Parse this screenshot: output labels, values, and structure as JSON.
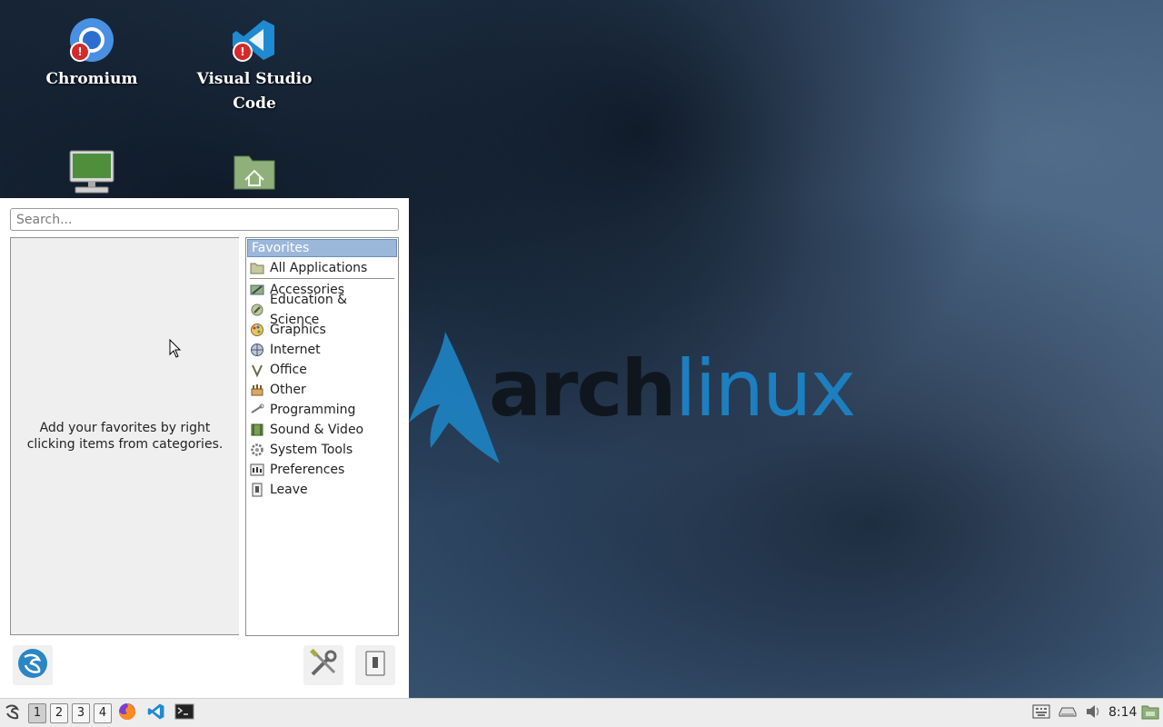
{
  "desktop": {
    "icons": [
      {
        "label": "Chromium",
        "warning": "!"
      },
      {
        "label": "Visual Studio Code",
        "warning": "!"
      },
      {
        "label": "",
        "icon": "computer-icon"
      },
      {
        "label": "",
        "icon": "home-folder-icon"
      }
    ],
    "wallpaper": {
      "logo_word_a": "arch",
      "logo_word_b": "linux"
    }
  },
  "menu": {
    "search_placeholder": "Search...",
    "favorites_hint": "Add your favorites by right clicking items from categories.",
    "categories_header": "Favorites",
    "categories": [
      {
        "label": "All Applications",
        "icon": "folder-icon"
      },
      {
        "label": "Accessories",
        "icon": "accessories-icon"
      },
      {
        "label": "Education & Science",
        "icon": "education-icon"
      },
      {
        "label": "Graphics",
        "icon": "graphics-icon"
      },
      {
        "label": "Internet",
        "icon": "internet-icon"
      },
      {
        "label": "Office",
        "icon": "office-icon"
      },
      {
        "label": "Other",
        "icon": "other-icon"
      },
      {
        "label": "Programming",
        "icon": "programming-icon"
      },
      {
        "label": "Sound & Video",
        "icon": "sound-video-icon"
      },
      {
        "label": "System Tools",
        "icon": "system-tools-icon"
      },
      {
        "label": "Preferences",
        "icon": "preferences-icon"
      },
      {
        "label": "Leave",
        "icon": "leave-icon"
      }
    ]
  },
  "panel": {
    "workspaces": [
      "1",
      "2",
      "3",
      "4"
    ],
    "active_workspace": "1",
    "clock": "8:14"
  },
  "colors": {
    "accent": "#9bb7d9",
    "arch_blue": "#1d7fbf"
  }
}
